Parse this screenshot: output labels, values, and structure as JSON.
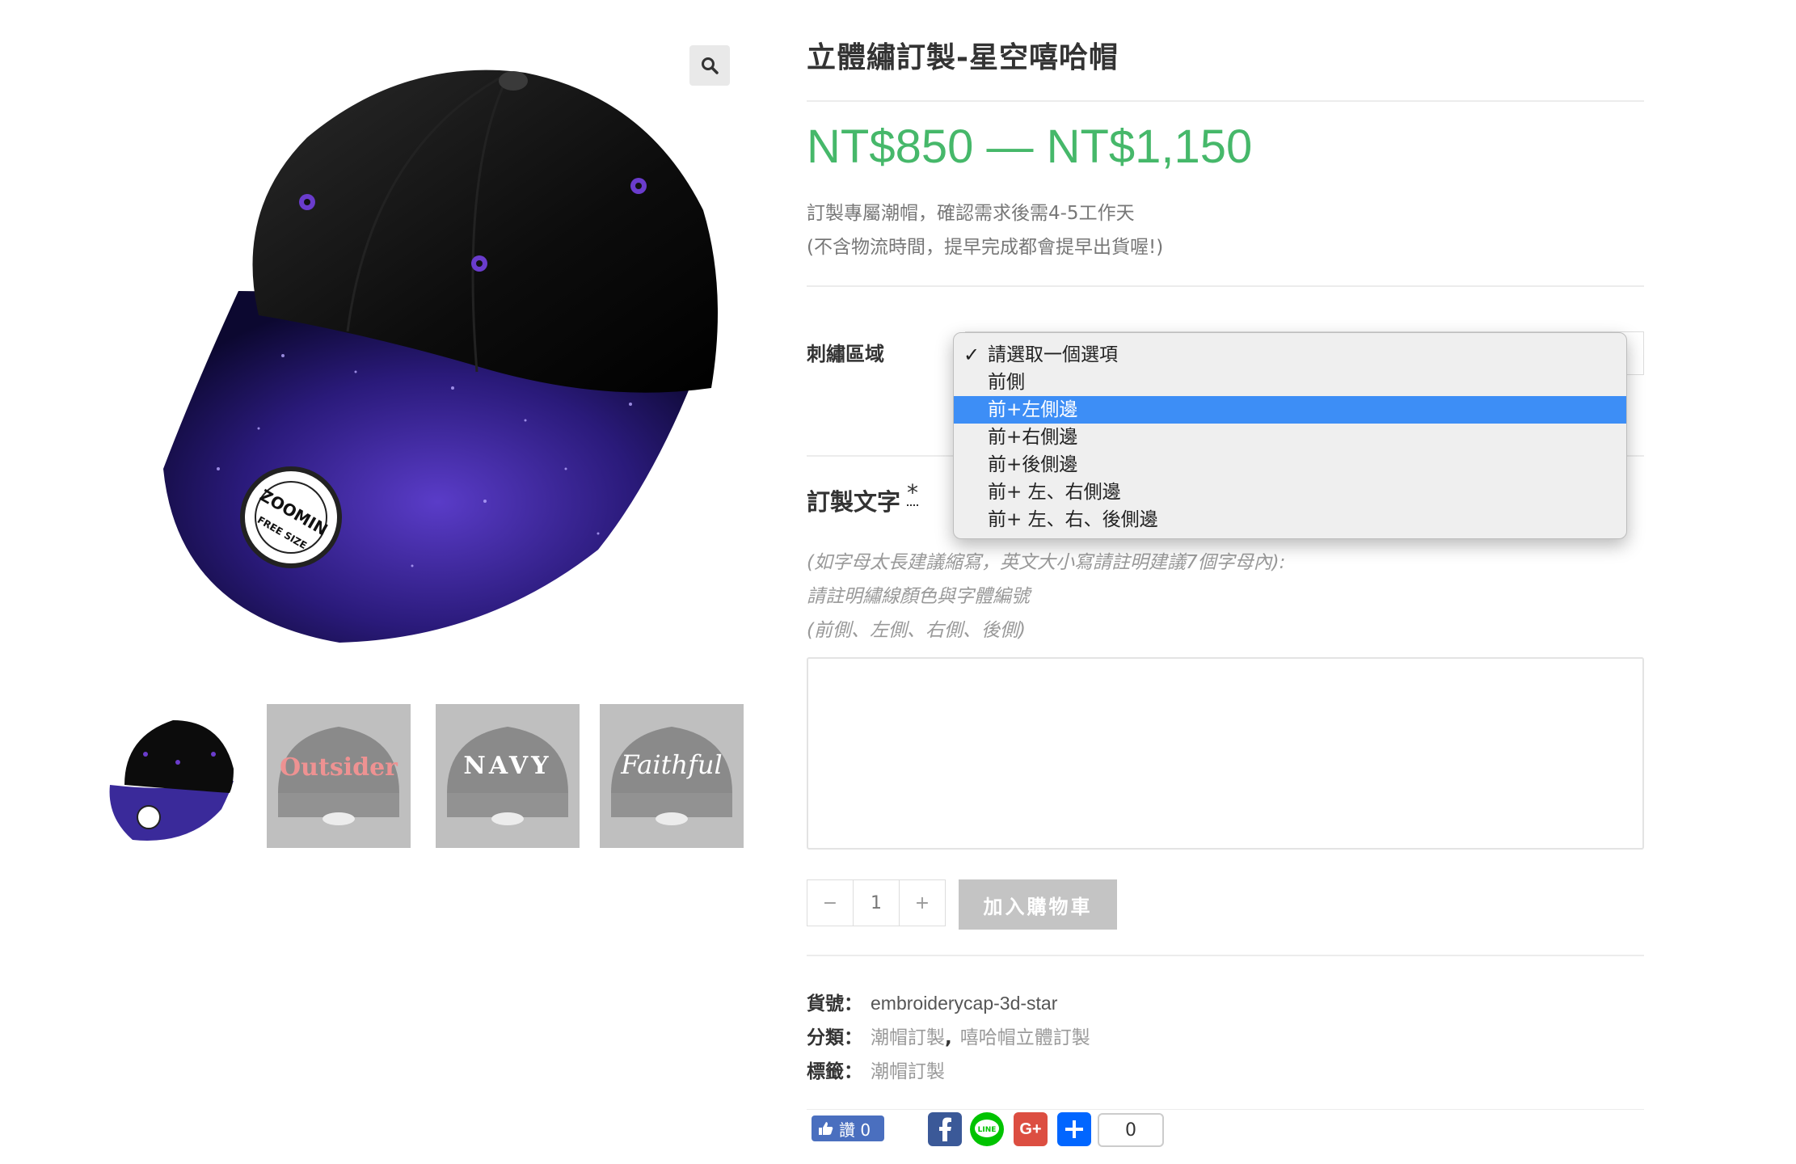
{
  "product": {
    "title": "立體繡訂製-星空嘻哈帽",
    "price": "NT$850 — NT$1,150",
    "description": [
      "訂製專屬潮帽，確認需求後需4-5工作天",
      "(不含物流時間，提早完成都會提早出貨喔!)"
    ]
  },
  "gallery": {
    "zoom_icon": "magnifier-icon",
    "thumbnails": [
      {
        "label": "",
        "name": "galaxy-cap"
      },
      {
        "label": "Outsider",
        "name": "outsider-cap"
      },
      {
        "label": "NAVY",
        "name": "navy-cap"
      },
      {
        "label": "Faithful",
        "name": "faithful-cap"
      }
    ],
    "badge_text": "ZOOMIN",
    "badge_sub": "FREE SIZE"
  },
  "variation": {
    "label": "刺繡區域",
    "options": [
      "請選取一個選項",
      "前側",
      "前+左側邊",
      "前+右側邊",
      "前+後側邊",
      "前+ 左、右側邊",
      "前+ 左、右、後側邊"
    ],
    "checked_index": 0,
    "highlighted_index": 2
  },
  "custom_text": {
    "label": "訂製文字",
    "required_mark": "*",
    "hints": [
      "(如字母太長建議縮寫，英文大小寫請註明建議7個字母內):",
      "請註明繡線顏色與字體編號",
      "(前側、左側、右側、後側)"
    ],
    "value": ""
  },
  "cart": {
    "minus": "−",
    "quantity": "1",
    "plus": "+",
    "add_label": "加入購物車"
  },
  "meta": {
    "sku_label": "貨號：",
    "sku": "embroiderycap-3d-star",
    "category_label": "分類：",
    "categories": [
      "潮帽訂製",
      "嘻哈帽立體訂製"
    ],
    "category_sep": ",",
    "tag_label": "標籤：",
    "tags": [
      "潮帽訂製"
    ]
  },
  "share": {
    "like_label": "讚 0",
    "count": "0",
    "buttons": [
      "facebook-icon",
      "line-icon",
      "google-plus-icon",
      "add-share-icon"
    ],
    "line_text": "LINE",
    "gplus_text": "G+"
  },
  "colors": {
    "price": "#46b86a",
    "highlight": "#3d8ef6",
    "facebook": "#3b5998",
    "line": "#00c300",
    "google_plus": "#dc4e41",
    "addtoany": "#0166ff"
  }
}
